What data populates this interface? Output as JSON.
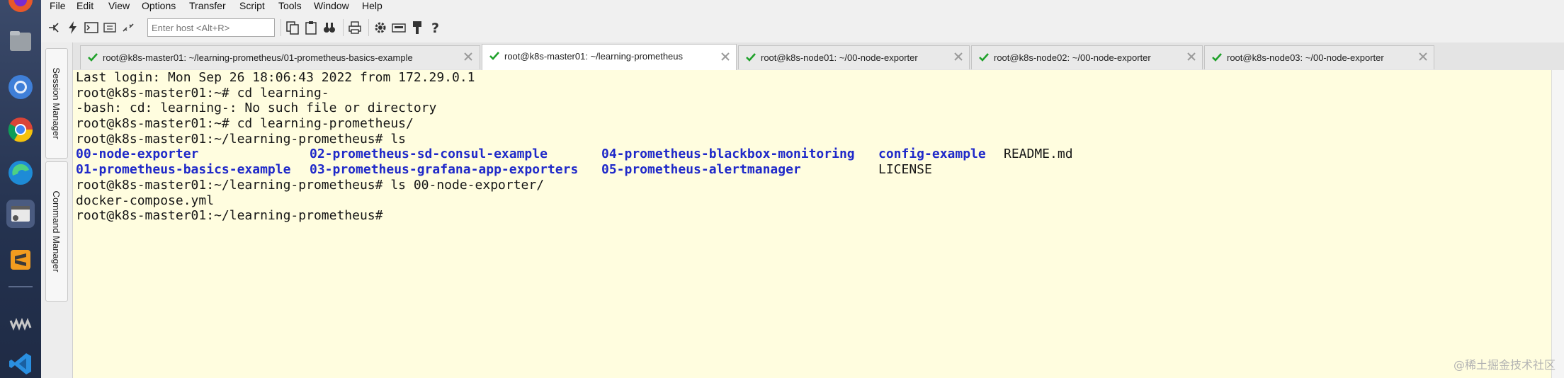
{
  "menu": [
    "File",
    "Edit",
    "View",
    "Options",
    "Transfer",
    "Script",
    "Tools",
    "Window",
    "Help"
  ],
  "toolbar": {
    "host_placeholder": "Enter host <Alt+R>",
    "icons": [
      "connect-icon",
      "quick-connect-icon",
      "new-tab-icon",
      "reconnect-icon",
      "disconnect-icon",
      "copy-icon",
      "paste-icon",
      "find-icon",
      "print-icon",
      "settings-icon",
      "keymap-icon",
      "sftp-icon",
      "help-icon"
    ]
  },
  "side_panel": {
    "session_manager": "Session Manager",
    "command_manager": "Command Manager"
  },
  "tabs": [
    {
      "label": "root@k8s-master01: ~/learning-prometheus/01-prometheus-basics-example",
      "active": false
    },
    {
      "label": "root@k8s-master01: ~/learning-prometheus",
      "active": true
    },
    {
      "label": "root@k8s-node01: ~/00-node-exporter",
      "active": false
    },
    {
      "label": "root@k8s-node02: ~/00-node-exporter",
      "active": false
    },
    {
      "label": "root@k8s-node03: ~/00-node-exporter",
      "active": false
    }
  ],
  "terminal": {
    "line1": "Last login: Mon Sep 26 18:06:43 2022 from 172.29.0.1",
    "line2": "root@k8s-master01:~# cd learning-",
    "line3": "-bash: cd: learning-: No such file or directory",
    "line4": "root@k8s-master01:~# cd learning-prometheus/",
    "line5": "root@k8s-master01:~/learning-prometheus# ls",
    "ls_row1": [
      "00-node-exporter",
      "02-prometheus-sd-consul-example",
      "04-prometheus-blackbox-monitoring",
      "config-example",
      "README.md"
    ],
    "ls_row2": [
      "01-prometheus-basics-example",
      "03-prometheus-grafana-app-exporters",
      "05-prometheus-alertmanager",
      "LICENSE"
    ],
    "line8": "root@k8s-master01:~/learning-prometheus# ls 00-node-exporter/",
    "line9": "docker-compose.yml",
    "line10": "root@k8s-master01:~/learning-prometheus#"
  },
  "watermark": "@稀土掘金技术社区",
  "colors": {
    "terminal_bg": "#fffddf",
    "directory": "#1f29c9",
    "check": "#1fa12a"
  }
}
